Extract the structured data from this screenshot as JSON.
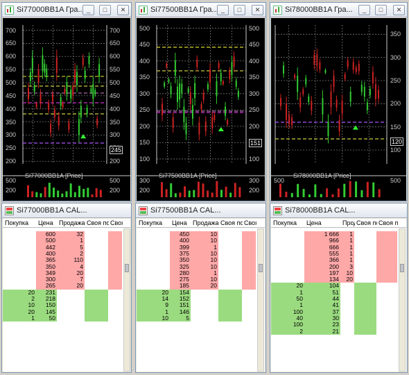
{
  "charts": [
    {
      "title": "Si77000BB1A Гра...",
      "legend": "Si77000BB1A [Price]",
      "ticks": [
        "700",
        "650",
        "600",
        "550",
        "500",
        "450",
        "400",
        "350",
        "300",
        "250",
        "200"
      ],
      "ticks_right": [
        "700",
        "650",
        "600",
        "550",
        "500",
        "450",
        "400",
        "350",
        "300",
        "250",
        "200"
      ],
      "current": "245",
      "sub_ticks": [
        "500",
        "200"
      ],
      "ymin": 190,
      "ymax": 720
    },
    {
      "title": "Si77500BB1A Гра...",
      "legend": "Si77500BB1A [Price]",
      "ticks": [
        "500",
        "450",
        "400",
        "350",
        "300",
        "250",
        "200",
        "150",
        "100"
      ],
      "ticks_right": [
        "500",
        "450",
        "400",
        "350",
        "300",
        "250",
        "200",
        "150",
        "100"
      ],
      "current": "151",
      "sub_ticks": [
        "300",
        "200"
      ],
      "ymin": 85,
      "ymax": 510
    },
    {
      "title": "Si78000BB1A Гра...",
      "legend": "Si78000BB1A [Price]",
      "ticks": [],
      "ticks_right": [
        "350",
        "300",
        "250",
        "200",
        "150",
        "100"
      ],
      "current": "120",
      "sub_ticks": [
        "500"
      ],
      "ymin": 70,
      "ymax": 370
    }
  ],
  "tables": [
    {
      "title": "Si77000BB1A CAL...",
      "headers": [
        "Покупка",
        "Цена",
        "Продажа",
        "Своя по",
        "Своя"
      ],
      "rows": [
        [
          "",
          "600",
          "32"
        ],
        [
          "",
          "500",
          "1"
        ],
        [
          "",
          "442",
          "5"
        ],
        [
          "",
          "400",
          "2"
        ],
        [
          "",
          "365",
          "110"
        ],
        [
          "",
          "350",
          "4"
        ],
        [
          "",
          "349",
          "20"
        ],
        [
          "",
          "300",
          "7"
        ],
        [
          "",
          "265",
          "20"
        ],
        [
          "20",
          "231",
          ""
        ],
        [
          "2",
          "218",
          ""
        ],
        [
          "10",
          "150",
          ""
        ],
        [
          "20",
          "145",
          ""
        ],
        [
          "1",
          "50",
          ""
        ]
      ],
      "sell_count": 9
    },
    {
      "title": "Si77500BB1A CAL...",
      "headers": [
        "Покупка",
        "Цена",
        "Продажа",
        "Своя по",
        "Своя"
      ],
      "rows": [
        [
          "",
          "450",
          "10"
        ],
        [
          "",
          "400",
          "10"
        ],
        [
          "",
          "399",
          "1"
        ],
        [
          "",
          "375",
          "10"
        ],
        [
          "",
          "350",
          "10"
        ],
        [
          "",
          "325",
          "10"
        ],
        [
          "",
          "280",
          "1"
        ],
        [
          "",
          "275",
          "10"
        ],
        [
          "",
          "185",
          "20"
        ],
        [
          "20",
          "154",
          ""
        ],
        [
          "14",
          "152",
          ""
        ],
        [
          "9",
          "151",
          ""
        ],
        [
          "1",
          "146",
          ""
        ],
        [
          "10",
          "5",
          ""
        ]
      ],
      "sell_count": 9
    },
    {
      "title": "Si78000BB1A CAL...",
      "headers": [
        "Покупка",
        "Цена",
        "Продажа",
        "Своя по",
        "Своя пр"
      ],
      "rows": [
        [
          "",
          "1 666",
          "1"
        ],
        [
          "",
          "966",
          "1"
        ],
        [
          "",
          "666",
          "1"
        ],
        [
          "",
          "555",
          "1"
        ],
        [
          "",
          "366",
          "1"
        ],
        [
          "",
          "200",
          "3"
        ],
        [
          "",
          "197",
          "10"
        ],
        [
          "",
          "134",
          "20"
        ],
        [
          "20",
          "104",
          ""
        ],
        [
          "1",
          "51",
          ""
        ],
        [
          "50",
          "44",
          ""
        ],
        [
          "1",
          "41",
          ""
        ],
        [
          "100",
          "37",
          ""
        ],
        [
          "40",
          "30",
          ""
        ],
        [
          "100",
          "23",
          ""
        ],
        [
          "2",
          "21",
          ""
        ]
      ],
      "sell_count": 8
    }
  ],
  "buttons": {
    "minimize": "_",
    "maximize": "□",
    "close": "✕"
  },
  "colors": {
    "sell": "#ffa8a8",
    "buy": "#9bdb80",
    "up_candle": "#33cc33",
    "down_candle": "#cc2222"
  }
}
